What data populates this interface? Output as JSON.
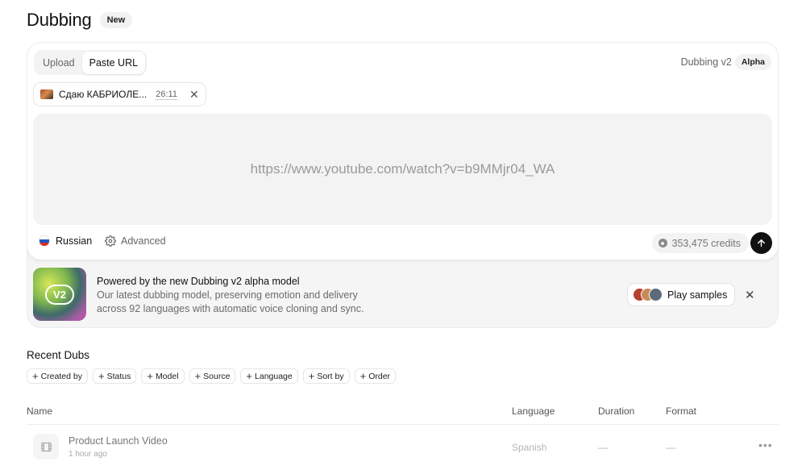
{
  "header": {
    "title": "Dubbing",
    "badge": "New"
  },
  "tabs": [
    {
      "label": "Upload"
    },
    {
      "label": "Paste URL"
    }
  ],
  "version": {
    "label": "Dubbing v2",
    "badge": "Alpha"
  },
  "video_chip": {
    "title": "Сдаю КАБРИОЛЕ...",
    "duration": "26:11"
  },
  "url_input": {
    "placeholder": "https://www.youtube.com/watch?v=b9MMjr04_WA"
  },
  "language": {
    "label": "Russian",
    "flag": [
      "#ffffff",
      "#1c57c9",
      "#d52b1e"
    ]
  },
  "advanced": {
    "label": "Advanced"
  },
  "credits": {
    "label": "353,475 credits"
  },
  "promo": {
    "thumb_label": "V2",
    "title": "Powered by the new Dubbing v2 alpha model",
    "description": "Our latest dubbing model, preserving emotion and delivery across 92 languages with automatic voice cloning and sync.",
    "samples_label": "Play samples"
  },
  "recent": {
    "title": "Recent Dubs",
    "filters": [
      "Created by",
      "Status",
      "Model",
      "Source",
      "Language",
      "Sort by",
      "Order"
    ],
    "columns": {
      "name": "Name",
      "language": "Language",
      "duration": "Duration",
      "format": "Format"
    },
    "rows": [
      {
        "name": "Product Launch Video",
        "time": "1 hour ago",
        "language": "Spanish",
        "duration": "—",
        "format": "—"
      }
    ]
  }
}
